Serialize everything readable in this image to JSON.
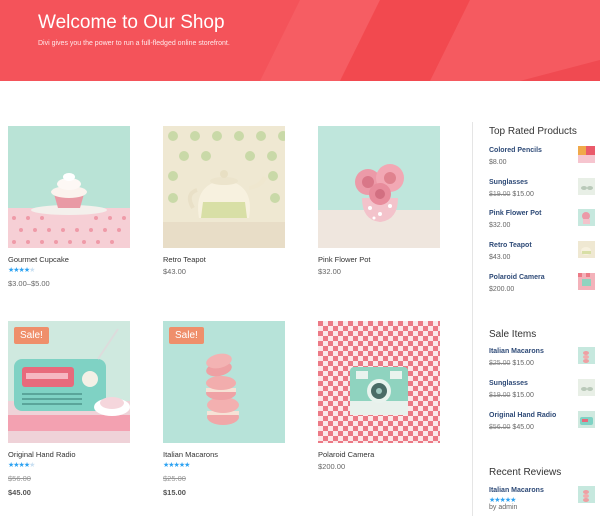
{
  "header": {
    "title": "Welcome to Our Shop",
    "subtitle": "Divi gives you the power to run a full-fledged online storefront.",
    "background_color": "#f4535a"
  },
  "products": [
    {
      "name": "Gourmet Cupcake",
      "price": "$3.00–$5.00",
      "rating": 4,
      "sale": false
    },
    {
      "name": "Retro Teapot",
      "price": "$43.00",
      "rating": 0,
      "sale": false
    },
    {
      "name": "Pink Flower Pot",
      "price": "$32.00",
      "rating": 0,
      "sale": false
    },
    {
      "name": "Original Hand Radio",
      "old_price": "$56.00",
      "price": "$45.00",
      "rating": 4,
      "sale": true,
      "sale_label": "Sale!"
    },
    {
      "name": "Italian Macarons",
      "old_price": "$25.00",
      "price": "$15.00",
      "rating": 5,
      "sale": true,
      "sale_label": "Sale!"
    },
    {
      "name": "Polaroid Camera",
      "price": "$200.00",
      "rating": 0,
      "sale": false
    }
  ],
  "sidebar": {
    "top_rated": {
      "title": "Top Rated Products",
      "items": [
        {
          "name": "Colored Pencils",
          "price": "$8.00"
        },
        {
          "name": "Sunglasses",
          "old_price": "$19.00",
          "price": "$15.00"
        },
        {
          "name": "Pink Flower Pot",
          "price": "$32.00"
        },
        {
          "name": "Retro Teapot",
          "price": "$43.00"
        },
        {
          "name": "Polaroid Camera",
          "price": "$200.00"
        }
      ]
    },
    "sale_items": {
      "title": "Sale Items",
      "items": [
        {
          "name": "Italian Macarons",
          "old_price": "$25.00",
          "price": "$15.00"
        },
        {
          "name": "Sunglasses",
          "old_price": "$19.00",
          "price": "$15.00"
        },
        {
          "name": "Original Hand Radio",
          "old_price": "$56.00",
          "price": "$45.00"
        }
      ]
    },
    "recent_reviews": {
      "title": "Recent Reviews",
      "items": [
        {
          "name": "Italian Macarons",
          "rating": 5,
          "author": "by admin"
        }
      ]
    }
  },
  "colors": {
    "accent": "#2ea3f2",
    "sale_badge": "#ef8f6b",
    "link": "#2e4a77"
  }
}
